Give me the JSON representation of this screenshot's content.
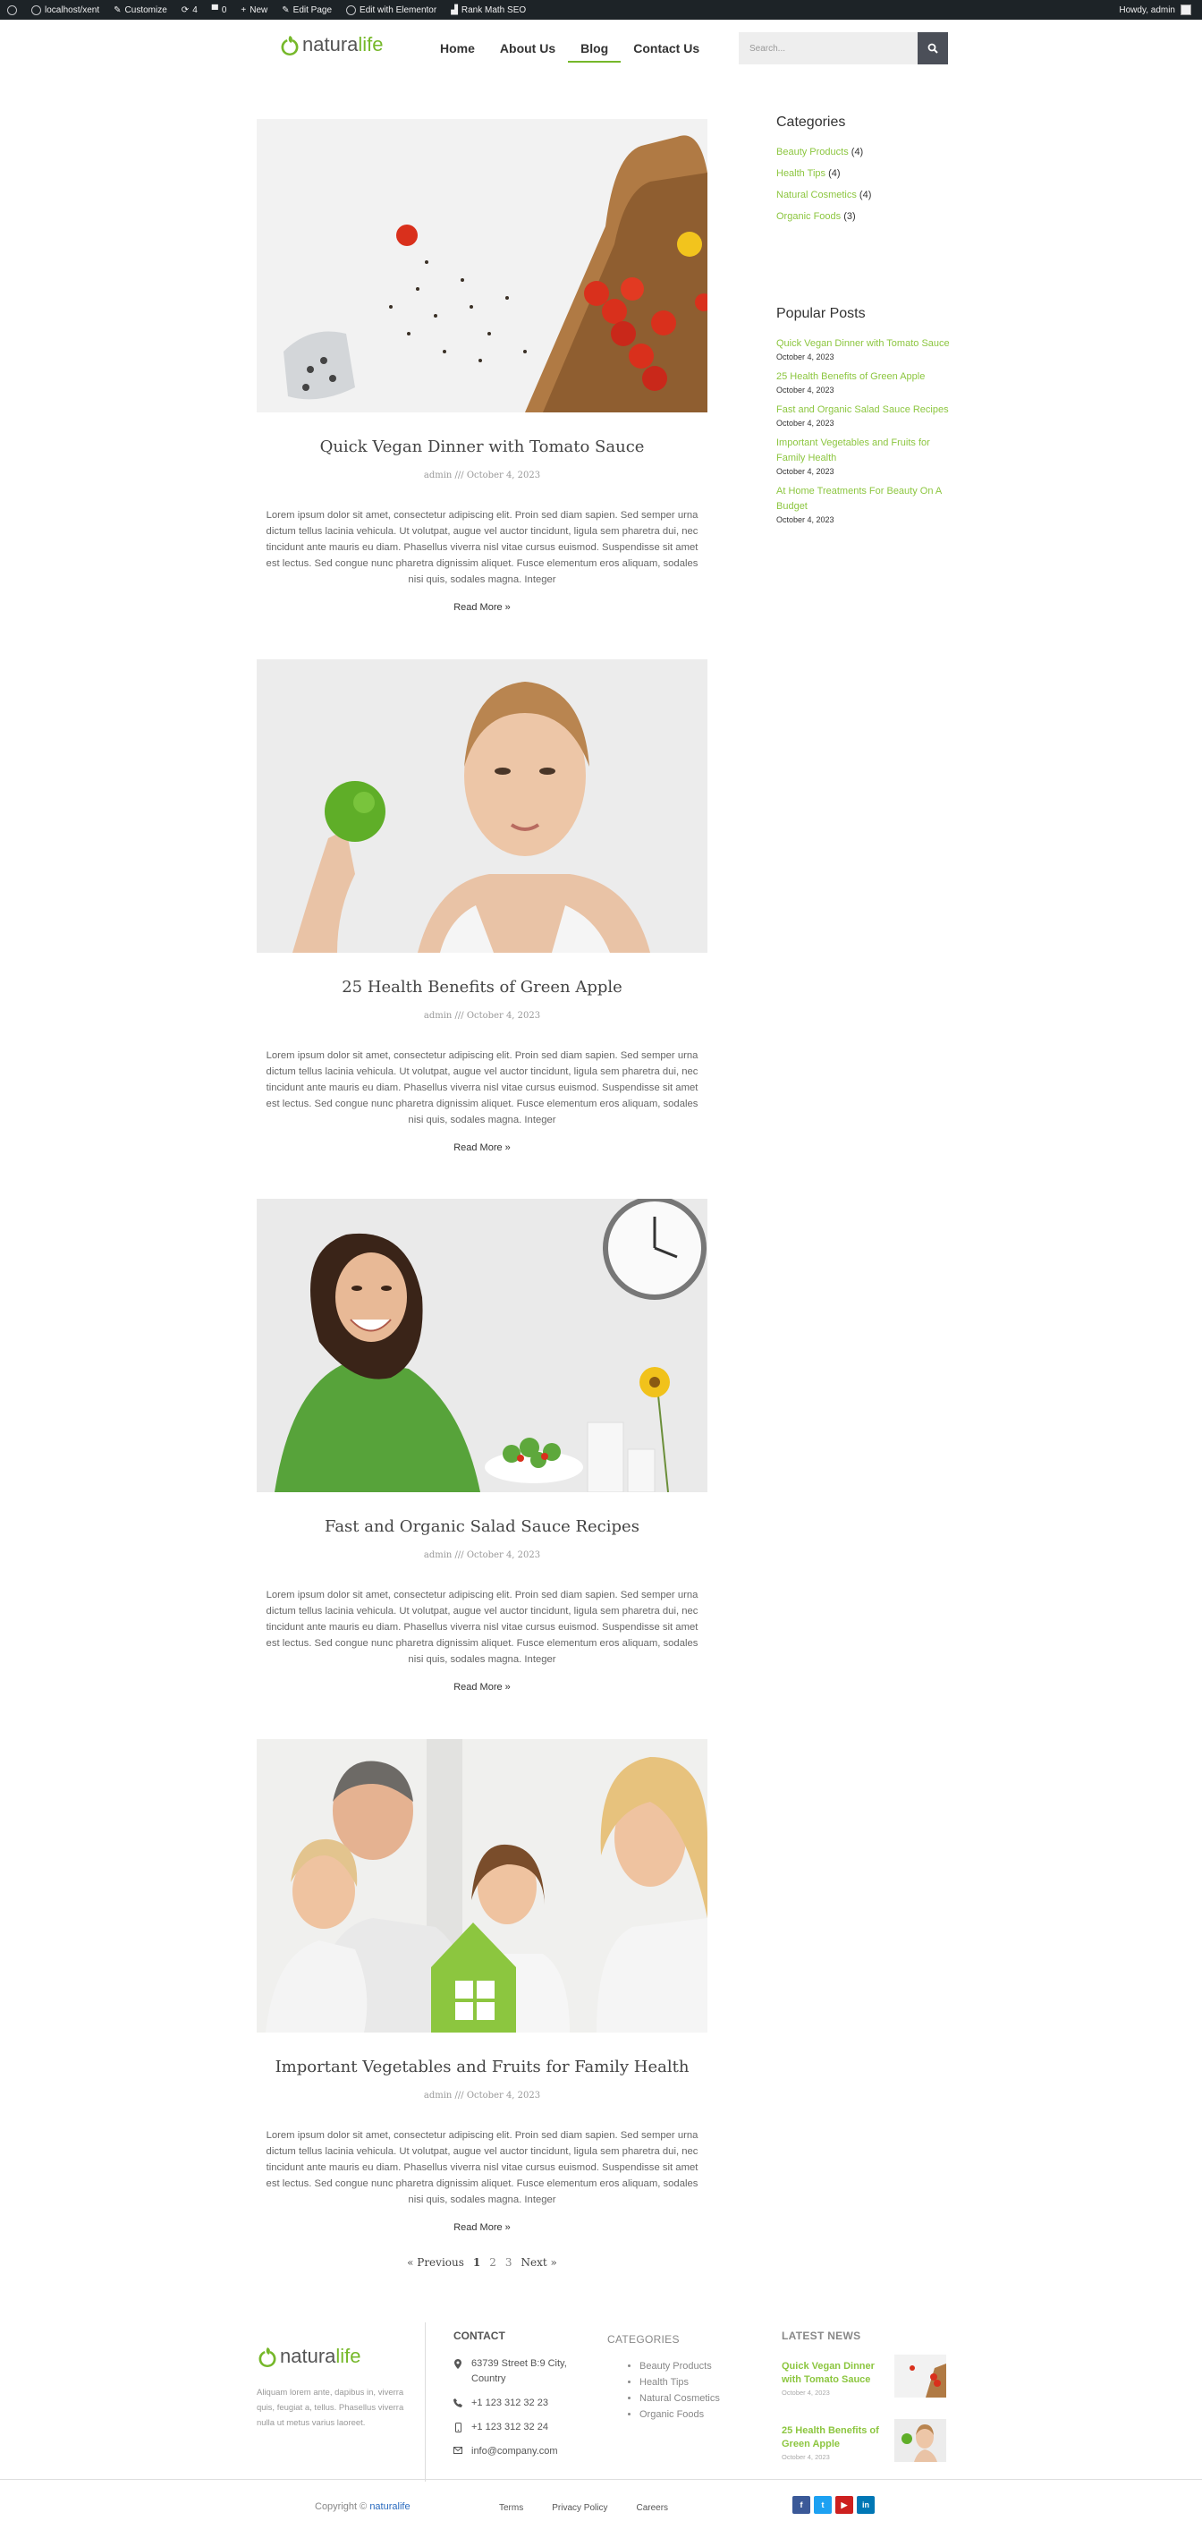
{
  "admin_bar": {
    "site": "localhost/xent",
    "customize": "Customize",
    "updates": "4",
    "comments": "0",
    "new": "New",
    "edit_page": "Edit Page",
    "elementor": "Edit with Elementor",
    "rank_math": "Rank Math SEO",
    "howdy": "Howdy, admin"
  },
  "header": {
    "logo_part1": "natura",
    "logo_part2": "life",
    "nav": [
      {
        "label": "Home"
      },
      {
        "label": "About Us"
      },
      {
        "label": "Blog"
      },
      {
        "label": "Contact Us"
      }
    ],
    "search_placeholder": "Search..."
  },
  "posts": [
    {
      "title": "Quick Vegan Dinner with Tomato Sauce",
      "meta": "admin /// October 4, 2023",
      "excerpt": "Lorem ipsum dolor sit amet, consectetur adipiscing elit. Proin sed diam sapien. Sed semper urna dictum tellus lacinia vehicula. Ut volutpat, augue vel auctor tincidunt, ligula sem pharetra dui, nec tincidunt ante mauris eu diam. Phasellus viverra nisl vitae cursus euismod. Suspendisse sit amet est lectus. Sed congue nunc pharetra dignissim aliquet. Fusce elementum eros aliquam, sodales nisi quis, sodales magna. Integer",
      "read_more": "Read More »"
    },
    {
      "title": "25 Health Benefits of Green Apple",
      "meta": "admin /// October 4, 2023",
      "excerpt": "Lorem ipsum dolor sit amet, consectetur adipiscing elit. Proin sed diam sapien. Sed semper urna dictum tellus lacinia vehicula. Ut volutpat, augue vel auctor tincidunt, ligula sem pharetra dui, nec tincidunt ante mauris eu diam. Phasellus viverra nisl vitae cursus euismod. Suspendisse sit amet est lectus. Sed congue nunc pharetra dignissim aliquet. Fusce elementum eros aliquam, sodales nisi quis, sodales magna. Integer",
      "read_more": "Read More »"
    },
    {
      "title": "Fast and Organic Salad Sauce Recipes",
      "meta": "admin /// October 4, 2023",
      "excerpt": "Lorem ipsum dolor sit amet, consectetur adipiscing elit. Proin sed diam sapien. Sed semper urna dictum tellus lacinia vehicula. Ut volutpat, augue vel auctor tincidunt, ligula sem pharetra dui, nec tincidunt ante mauris eu diam. Phasellus viverra nisl vitae cursus euismod. Suspendisse sit amet est lectus. Sed congue nunc pharetra dignissim aliquet. Fusce elementum eros aliquam, sodales nisi quis, sodales magna. Integer",
      "read_more": "Read More »"
    },
    {
      "title": "Important Vegetables and Fruits for Family Health",
      "meta": "admin /// October 4, 2023",
      "excerpt": "Lorem ipsum dolor sit amet, consectetur adipiscing elit. Proin sed diam sapien. Sed semper urna dictum tellus lacinia vehicula. Ut volutpat, augue vel auctor tincidunt, ligula sem pharetra dui, nec tincidunt ante mauris eu diam. Phasellus viverra nisl vitae cursus euismod. Suspendisse sit amet est lectus. Sed congue nunc pharetra dignissim aliquet. Fusce elementum eros aliquam, sodales nisi quis, sodales magna. Integer",
      "read_more": "Read More »"
    }
  ],
  "sidebar": {
    "categories_title": "Categories",
    "categories": [
      {
        "name": "Beauty Products",
        "count": "(4)"
      },
      {
        "name": "Health Tips",
        "count": "(4)"
      },
      {
        "name": "Natural Cosmetics",
        "count": "(4)"
      },
      {
        "name": "Organic Foods",
        "count": "(3)"
      }
    ],
    "popular_title": "Popular Posts",
    "popular": [
      {
        "title": "Quick Vegan Dinner with Tomato Sauce",
        "date": "October 4, 2023"
      },
      {
        "title": "25 Health Benefits of Green Apple",
        "date": "October 4, 2023"
      },
      {
        "title": "Fast and Organic Salad Sauce Recipes",
        "date": "October 4, 2023"
      },
      {
        "title": "Important Vegetables and Fruits for Family Health",
        "date": "October 4, 2023"
      },
      {
        "title": "At Home Treatments For Beauty On A Budget",
        "date": "October 4, 2023"
      }
    ]
  },
  "pagination": {
    "prev": "« Previous",
    "pages": [
      "1",
      "2",
      "3"
    ],
    "next": "Next »"
  },
  "footer": {
    "about": "Aliquam lorem ante, dapibus in, viverra quis, feugiat a, tellus. Phasellus viverra nulla ut metus varius laoreet.",
    "contact_title": "CONTACT",
    "address": "63739 Street B:9 City, Country",
    "phone": "+1 123 312 32 23",
    "mobile": "+1 123 312 32 24",
    "email": "info@company.com",
    "categories_title": "CATEGORIES",
    "categories": [
      "Beauty Products",
      "Health Tips",
      "Natural Cosmetics",
      "Organic Foods"
    ],
    "latest_title": "LATEST NEWS",
    "latest": [
      {
        "title": "Quick Vegan Dinner with Tomato Sauce",
        "date": "October 4, 2023"
      },
      {
        "title": "25 Health Benefits of Green Apple",
        "date": "October 4, 2023"
      }
    ],
    "copyright_prefix": "Copyright ©",
    "copyright_brand": "naturalife",
    "links": [
      "Terms",
      "Privacy Policy",
      "Careers"
    ],
    "social": [
      {
        "icon": "facebook-icon",
        "glyph": "f",
        "color": "#3b5998"
      },
      {
        "icon": "twitter-icon",
        "glyph": "t",
        "color": "#1da1f2"
      },
      {
        "icon": "youtube-icon",
        "glyph": "▶",
        "color": "#cd201f"
      },
      {
        "icon": "linkedin-icon",
        "glyph": "in",
        "color": "#0077b5"
      }
    ]
  },
  "colors": {
    "accent": "#76b82a",
    "link_green": "#8cc63f",
    "admin_bar": "#1d2327"
  }
}
